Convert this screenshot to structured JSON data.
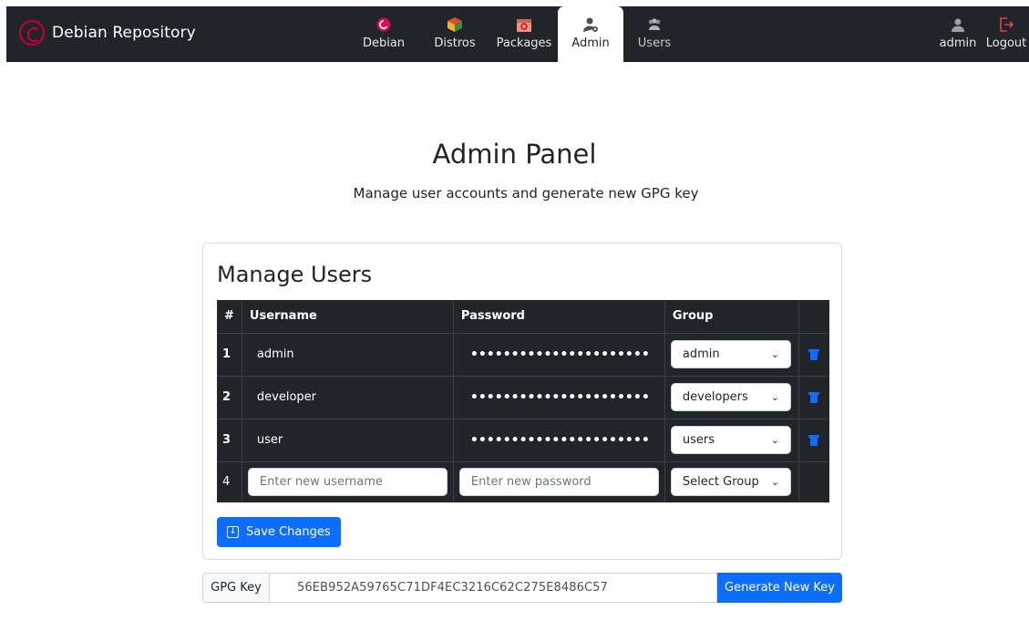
{
  "brand": {
    "name": "Debian Repository"
  },
  "nav": {
    "items": [
      {
        "label": "Debian",
        "icon": "debian-swirl-icon",
        "active": false
      },
      {
        "label": "Distros",
        "icon": "box-icon",
        "active": false
      },
      {
        "label": "Packages",
        "icon": "package-icon",
        "active": false
      },
      {
        "label": "Admin",
        "icon": "admin-user-icon",
        "active": true
      },
      {
        "label": "Users",
        "icon": "users-icon",
        "active": false
      }
    ],
    "user": {
      "label": "admin",
      "icon": "user-icon"
    },
    "logout": {
      "label": "Logout",
      "icon": "logout-icon"
    }
  },
  "page": {
    "title": "Admin Panel",
    "subtitle": "Manage user accounts and generate new GPG key"
  },
  "manage_users": {
    "title": "Manage Users",
    "columns": [
      "#",
      "Username",
      "Password",
      "Group",
      ""
    ],
    "rows": [
      {
        "num": "1",
        "username": "admin",
        "password": "••••••••••••••••••••••",
        "group": "admin"
      },
      {
        "num": "2",
        "username": "developer",
        "password": "••••••••••••••••••••••",
        "group": "developers"
      },
      {
        "num": "3",
        "username": "user",
        "password": "••••••••••••••••••••••",
        "group": "users"
      }
    ],
    "new_row": {
      "num": "4",
      "username_placeholder": "Enter new username",
      "password_placeholder": "Enter new password",
      "group_placeholder": "Select Group"
    },
    "save_label": "Save Changes"
  },
  "gpg": {
    "label": "GPG Key",
    "value": "56EB952A59765C71DF4EC3216C62C275E8486C57",
    "button_label": "Generate New Key"
  },
  "colors": {
    "navbar": "#212529",
    "primary": "#0d6efd",
    "debian_red": "#c80037"
  }
}
